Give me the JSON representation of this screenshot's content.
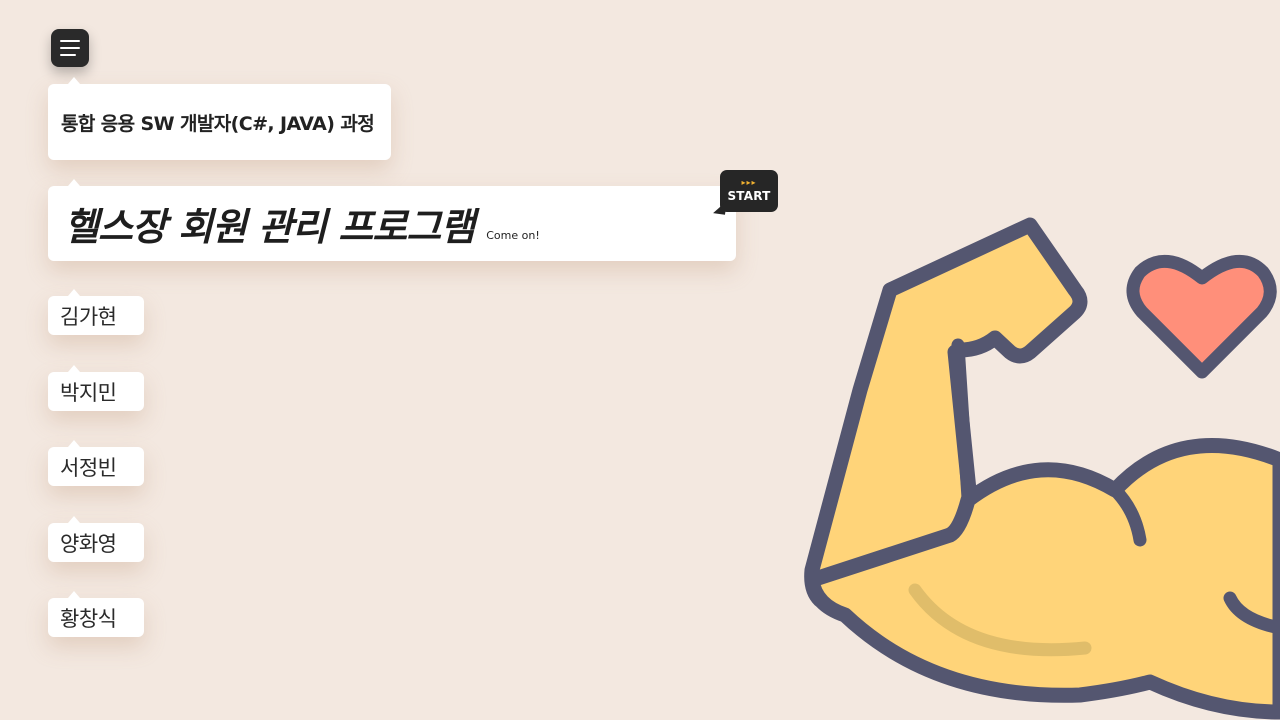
{
  "menu": {
    "icon": "hamburger-menu-icon"
  },
  "course": {
    "title": "통합 응용 SW 개발자(C#, JAVA) 과정"
  },
  "program": {
    "title": "헬스장 회원 관리 프로그램",
    "subtitle": "Come on!"
  },
  "start": {
    "arrows": "▸▸▸",
    "label": "START"
  },
  "members": [
    "김가현",
    "박지민",
    "서정빈",
    "양화영",
    "황창식"
  ],
  "illustration": {
    "icons": [
      "flexed-arm-icon",
      "heart-icon"
    ],
    "colors": {
      "arm": "#ffd479",
      "outline": "#545670",
      "heart": "#ff8f7a",
      "background": "#f3e8e0"
    }
  }
}
